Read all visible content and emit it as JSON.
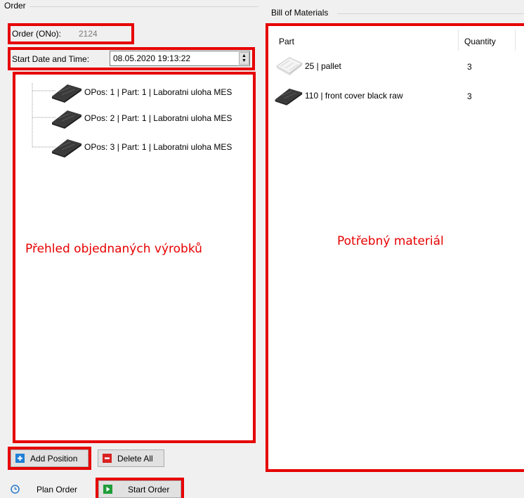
{
  "order_group": {
    "title": "Order",
    "order_no_label": "Order (ONo):",
    "order_no_value": "2124",
    "start_label": "Start Date and Time:",
    "start_value": "08.05.2020 19:13:22"
  },
  "positions": {
    "items": [
      {
        "label": "OPos: 1 | Part: 1 | Laboratni uloha MES",
        "icon": "part-cover-icon"
      },
      {
        "label": "OPos: 2 | Part: 1 | Laboratni uloha MES",
        "icon": "part-cover-icon"
      },
      {
        "label": "OPos: 3 | Part: 1 | Laboratni uloha MES",
        "icon": "part-cover-icon"
      }
    ],
    "annotation": "Přehled objednaných výrobků",
    "add_label": "Add Position",
    "delete_label": "Delete All"
  },
  "bom": {
    "title": "Bill of Materials",
    "col_part": "Part",
    "col_quantity": "Quantity",
    "rows": [
      {
        "part": "25 | pallet",
        "quantity": "3",
        "icon": "pallet-icon"
      },
      {
        "part": "110 | front cover black raw",
        "quantity": "3",
        "icon": "part-cover-icon"
      }
    ],
    "annotation": "Potřebný materiál"
  },
  "footer": {
    "plan_label": "Plan Order",
    "start_label": "Start Order"
  },
  "colors": {
    "highlight": "#e60000",
    "add_icon": "#1e7fd6",
    "delete_icon": "#d92121",
    "start_icon": "#1f9d3a",
    "plan_icon": "#2a78c9"
  }
}
